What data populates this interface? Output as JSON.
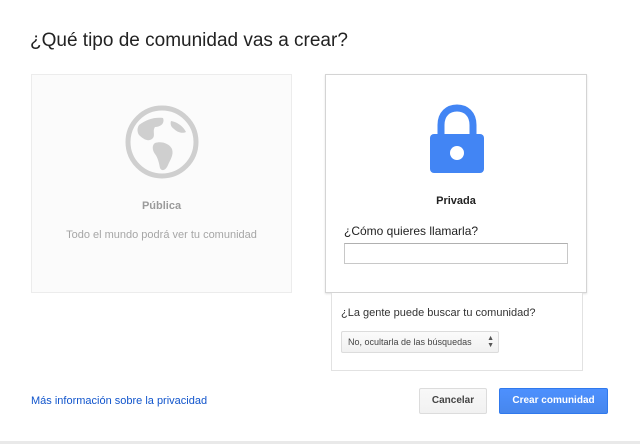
{
  "dialog": {
    "title": "¿Qué tipo de comunidad vas a crear?"
  },
  "public_card": {
    "icon": "globe-icon",
    "label": "Pública",
    "description": "Todo el mundo podrá ver tu comunidad"
  },
  "private_card": {
    "icon": "lock-icon",
    "label": "Privada",
    "name_question": "¿Cómo quieres llamarla?",
    "name_value": "",
    "name_placeholder": ""
  },
  "search_visibility": {
    "question": "¿La gente puede buscar tu comunidad?",
    "selected_option": "No, ocultarla de las búsquedas"
  },
  "footer": {
    "privacy_link": "Más información sobre la privacidad",
    "cancel_label": "Cancelar",
    "create_label": "Crear comunidad"
  },
  "colors": {
    "accent": "#4d90fe",
    "lock_blue": "#4285f4",
    "globe_gray": "#cfcfcf",
    "link": "#1155cc"
  }
}
